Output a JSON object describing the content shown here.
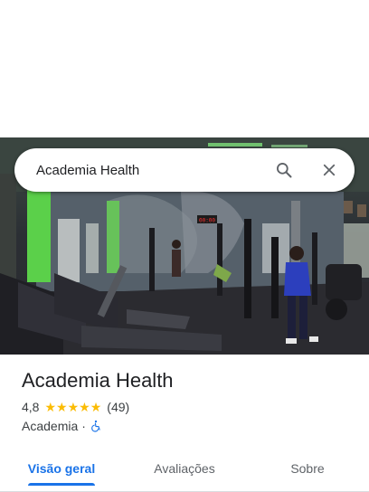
{
  "search": {
    "query": "Academia Health"
  },
  "place": {
    "name": "Academia Health",
    "rating": "4,8",
    "rating_value": 4.8,
    "review_count": "(49)",
    "category": "Academia",
    "separator": "·",
    "wheelchair_accessible": true
  },
  "tabs": [
    {
      "label": "Visão geral",
      "active": true
    },
    {
      "label": "Avaliações",
      "active": false
    },
    {
      "label": "Sobre",
      "active": false
    }
  ],
  "photo": {
    "clock_display": "00:00"
  },
  "colors": {
    "accent": "#1a73e8",
    "star": "#fbbc04",
    "wall_green": "#5bd04a",
    "text_primary": "#202124",
    "text_secondary": "#5f6368"
  },
  "icons": {
    "search": "search-icon",
    "close": "close-icon",
    "star": "star-icon",
    "accessibility": "wheelchair-icon"
  }
}
